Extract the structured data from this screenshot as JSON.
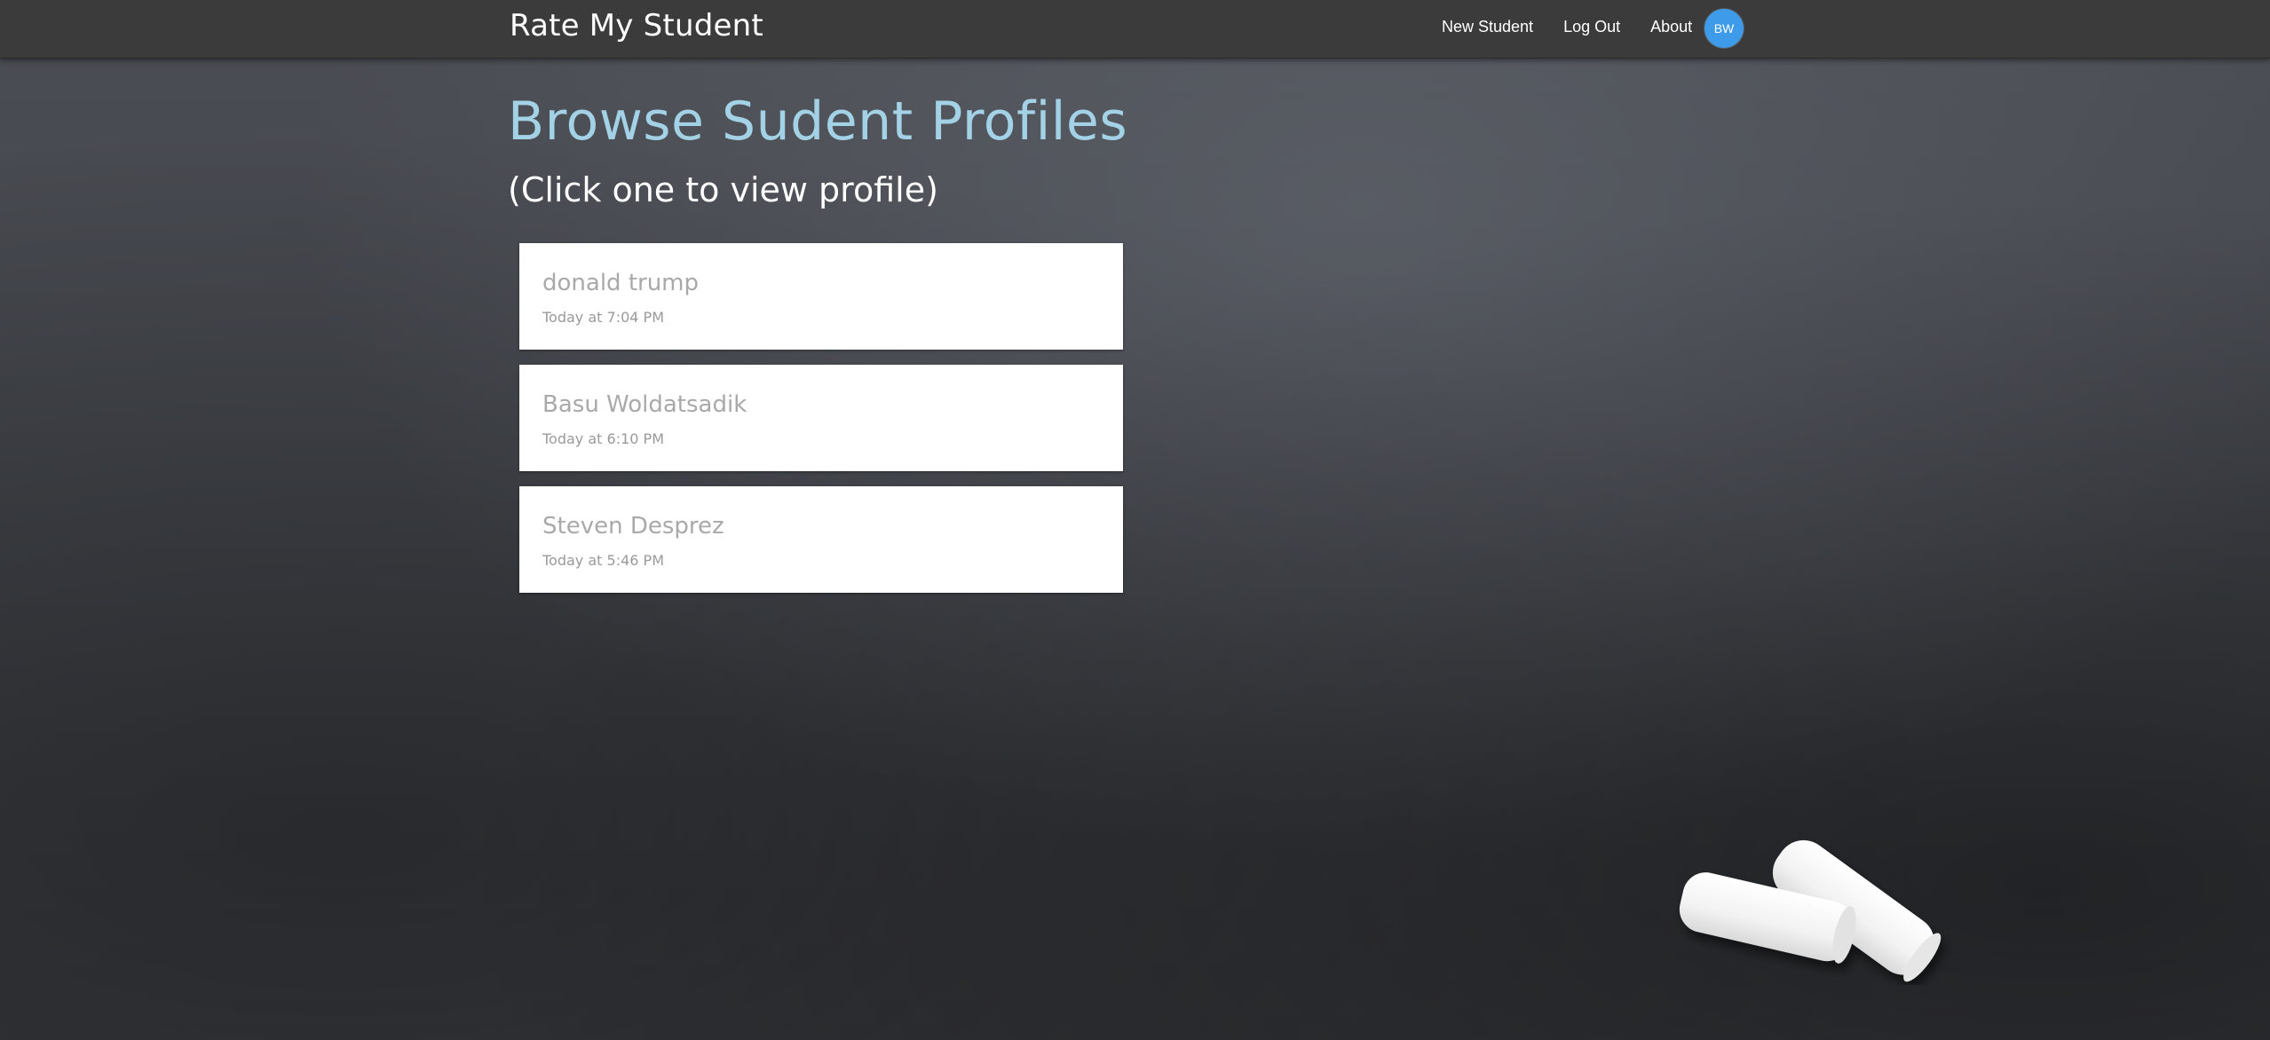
{
  "navbar": {
    "brand": "Rate My Student",
    "links": [
      {
        "label": "New Student"
      },
      {
        "label": "Log Out"
      },
      {
        "label": "About"
      }
    ],
    "avatar_initials": "BW",
    "avatar_color": "#3d9be9"
  },
  "main": {
    "title": "Browse Sudent Profiles",
    "subtitle": "(Click one to view profile)",
    "students": [
      {
        "name": "donald trump",
        "time": "Today at 7:04 PM"
      },
      {
        "name": "Basu Woldatsadik",
        "time": "Today at 6:10 PM"
      },
      {
        "name": "Steven Desprez",
        "time": "Today at 5:46 PM"
      }
    ]
  },
  "colors": {
    "title": "#a3d2e6",
    "navbar_bg": "#3b3b3b",
    "card_bg": "#ffffff"
  }
}
